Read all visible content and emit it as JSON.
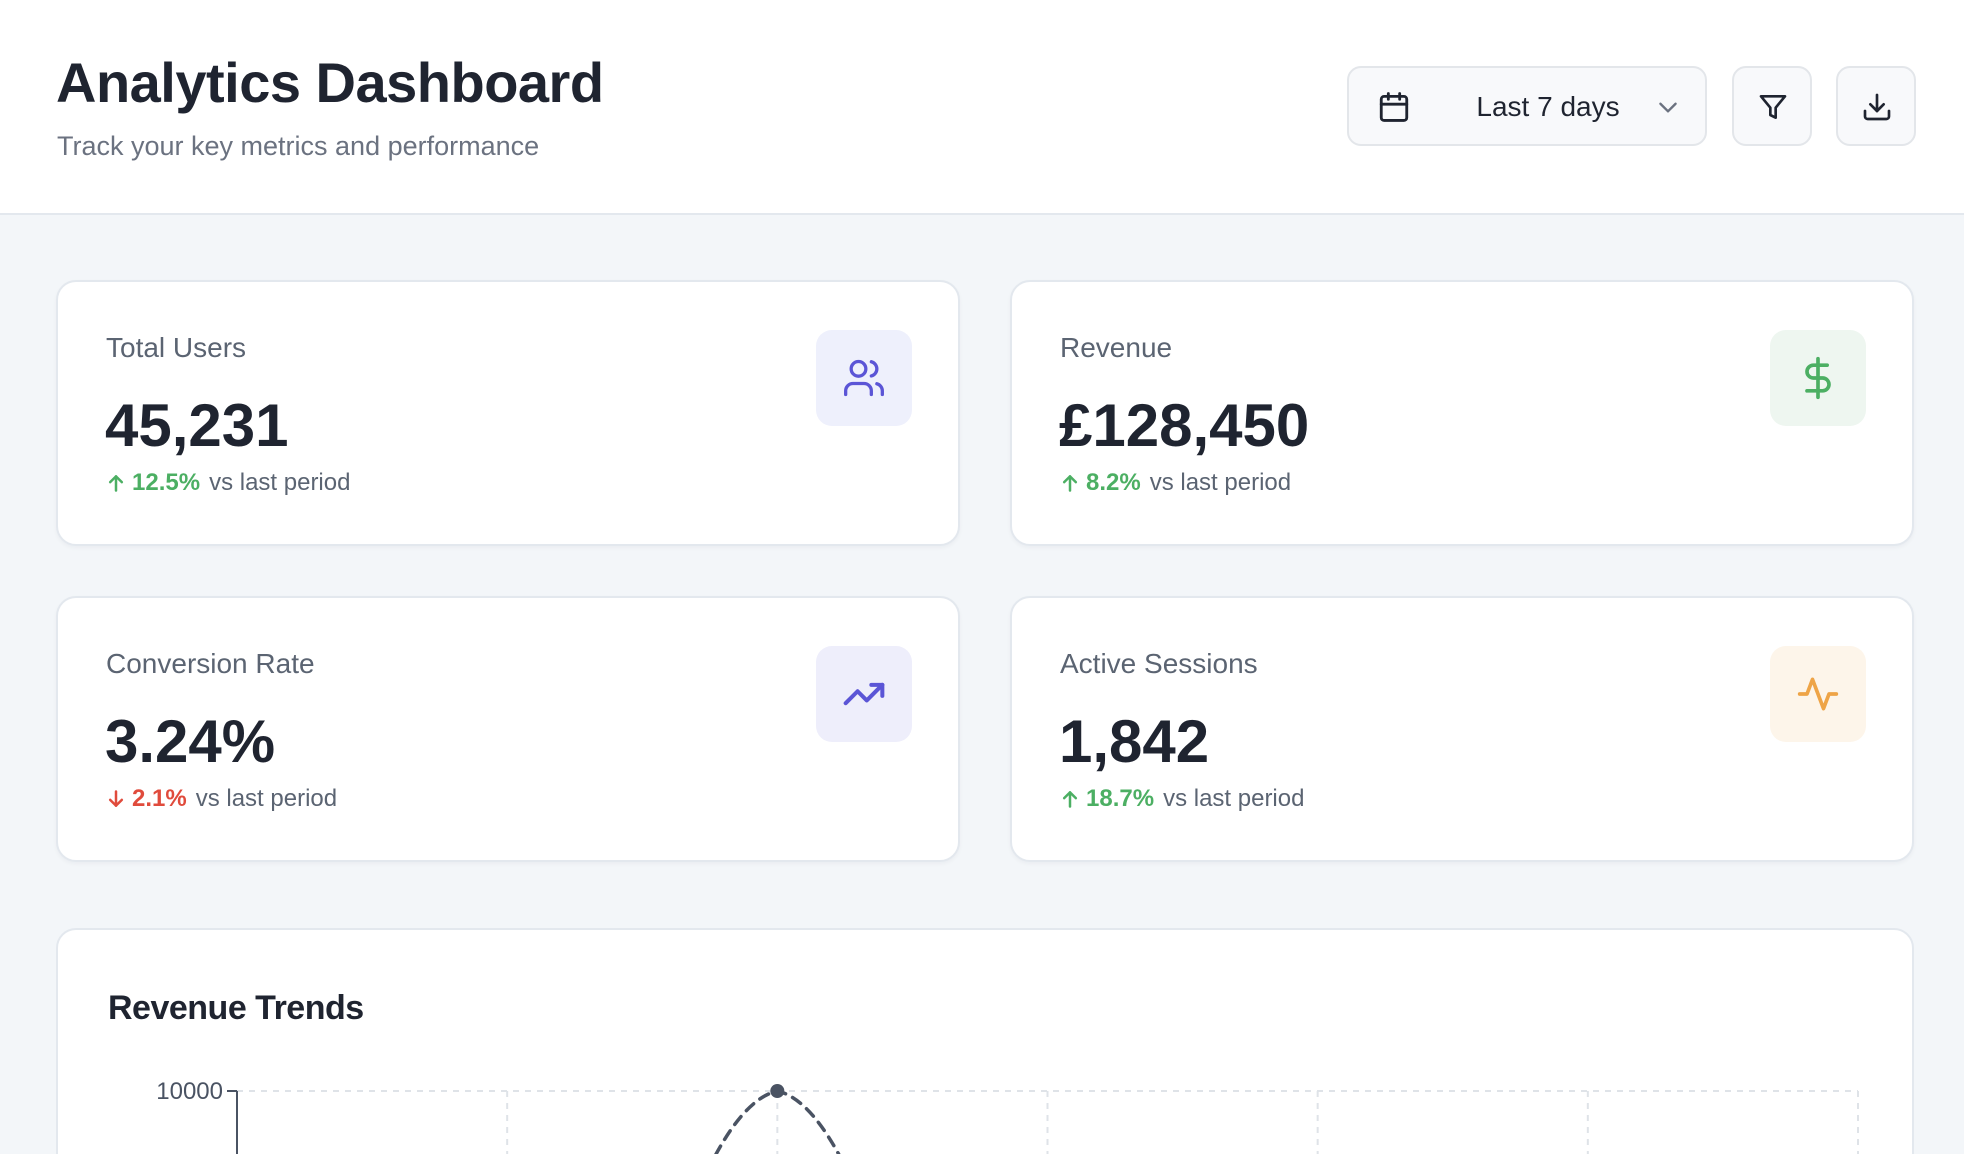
{
  "header": {
    "title": "Analytics Dashboard",
    "subtitle": "Track your key metrics and performance",
    "date_range": {
      "label": "Last 7 days",
      "icon": "calendar-icon",
      "dropdown_icon": "chevron-down-icon"
    },
    "filter_icon": "filter-icon",
    "download_icon": "download-icon"
  },
  "stats": [
    {
      "label": "Total Users",
      "value": "45,231",
      "change": "12.5%",
      "direction": "up",
      "suffix": "vs last period",
      "icon": "users-icon",
      "icon_color": "#5b55d6",
      "icon_bg": "#eef0fc",
      "change_color": "#4caf63"
    },
    {
      "label": "Revenue",
      "value": "£128,450",
      "change": "8.2%",
      "direction": "up",
      "suffix": "vs last period",
      "icon": "dollar-icon",
      "icon_color": "#4caf63",
      "icon_bg": "#eef6f0",
      "change_color": "#4caf63"
    },
    {
      "label": "Conversion Rate",
      "value": "3.24%",
      "change": "2.1%",
      "direction": "down",
      "suffix": "vs last period",
      "icon": "trending-up-icon",
      "icon_color": "#5b55d6",
      "icon_bg": "#eeeefb",
      "change_color": "#e04b3c"
    },
    {
      "label": "Active Sessions",
      "value": "1,842",
      "change": "18.7%",
      "direction": "up",
      "suffix": "vs last period",
      "icon": "activity-icon",
      "icon_color": "#eea447",
      "icon_bg": "#fdf5ea",
      "change_color": "#4caf63"
    }
  ],
  "chart": {
    "title": "Revenue Trends"
  },
  "chart_data": {
    "type": "line",
    "title": "Revenue Trends",
    "y_ticks": [
      "10000"
    ],
    "ylim_top": 10000,
    "x_gridlines": 7,
    "grid": "dashed",
    "series": [
      {
        "points": [
          {
            "x": 2,
            "y": 10000
          }
        ],
        "line_style": "dashed",
        "color": "#4a5363"
      }
    ]
  }
}
